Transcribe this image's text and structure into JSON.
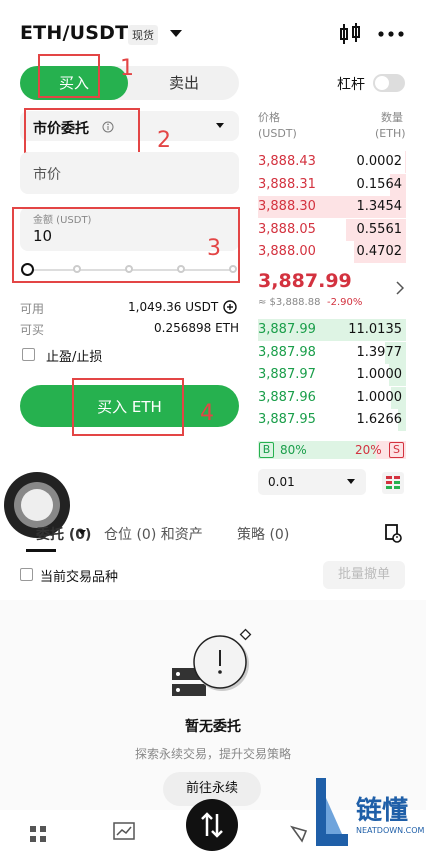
{
  "header": {
    "pair": "ETH/USDT",
    "badge": "现货"
  },
  "side_tabs": {
    "buy": "买入",
    "sell": "卖出"
  },
  "leverage": {
    "label": "杠杆"
  },
  "order_type": {
    "label": "市价委托"
  },
  "price_field": {
    "label": "市价"
  },
  "amount_field": {
    "label": "金额 (USDT)",
    "value": "10"
  },
  "slider": {
    "level_percent": 0
  },
  "account": {
    "available_label": "可用",
    "available_value": "1,049.36 USDT",
    "can_buy_label": "可买",
    "can_buy_value": "0.256898 ETH"
  },
  "tp_sl": {
    "label": "止盈/止损"
  },
  "submit": {
    "label": "买入 ETH"
  },
  "annotations": [
    "1",
    "2",
    "3",
    "4"
  ],
  "orderbook": {
    "price_header": "价格",
    "price_unit": "(USDT)",
    "qty_header": "数量",
    "qty_unit": "(ETH)",
    "asks": [
      {
        "price": "3,888.43",
        "qty": "0.0002"
      },
      {
        "price": "3,888.31",
        "qty": "0.1564"
      },
      {
        "price": "3,888.30",
        "qty": "1.3454"
      },
      {
        "price": "3,888.05",
        "qty": "0.5561"
      },
      {
        "price": "3,888.00",
        "qty": "0.4702"
      }
    ],
    "last_price": "3,887.99",
    "ref_price": "≈ $3,888.88",
    "change": "-2.90%",
    "bids": [
      {
        "price": "3,887.99",
        "qty": "11.0135"
      },
      {
        "price": "3,887.98",
        "qty": "1.3977"
      },
      {
        "price": "3,887.97",
        "qty": "1.0000"
      },
      {
        "price": "3,887.96",
        "qty": "1.0000"
      },
      {
        "price": "3,887.95",
        "qty": "1.6266"
      }
    ],
    "ratio": {
      "b_label": "B",
      "b_pct": "80%",
      "s_pct": "20%",
      "s_label": "S"
    },
    "precision": "0.01"
  },
  "bottom_tabs": {
    "orders": "委托 (0)",
    "positions": "仓位 (0) 和资产",
    "strategies": "策略 (0)"
  },
  "filter": {
    "label": "当前交易品种",
    "cancel_all": "批量撤单"
  },
  "empty": {
    "title": "暂无委托",
    "subtitle": "探索永续交易，提升交易策略",
    "button": "前往永续"
  },
  "watermark": {
    "brand": "链懂",
    "url": "NEATDOWN.COM"
  },
  "colors": {
    "green": "#26b14f",
    "red": "#d3323f"
  }
}
